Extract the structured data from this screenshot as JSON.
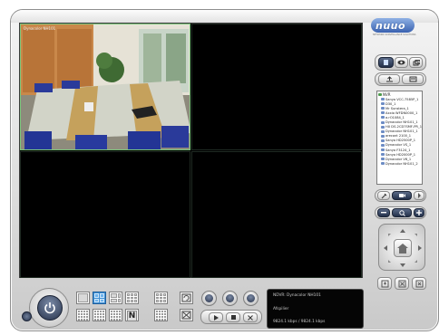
{
  "app": {
    "brand": "nuuo",
    "brand_tagline": "NETWORK SURVEILLANCE SOLUTIONS"
  },
  "colors": {
    "active_cell_border": "#7cc77c",
    "active_layout": "#3f8fd3",
    "screen_bg": "#000000"
  },
  "video_wall": {
    "cells": [
      {
        "label": "Dynacolor NH101",
        "active": true
      },
      {
        "label": "",
        "active": false
      },
      {
        "label": "",
        "active": false
      },
      {
        "label": "",
        "active": false
      }
    ]
  },
  "camera_tree": {
    "root": "NVR",
    "items": [
      "Sanyo VCC-7585P_1",
      "D30_1",
      "Mr Sunstera_1",
      "Axxio WFDN0000_1",
      "a.rO1084_1",
      "Dynacolor NH101_1",
      "HX DS-2CD7SMF-PR_1",
      "Dynacolor NH101_1",
      "arecont 2100_1",
      "Sanyo HD2500P_1",
      "Dynacolor VS_1",
      "Sanyo F3124_1",
      "Sanyo HD2000P_1",
      "Dynacolor V6_1",
      "Dynacolor NH101_2"
    ]
  },
  "side_icons": [
    "monitor-icon",
    "eye-icon",
    "windows-icon",
    "export-icon",
    "import-icon"
  ],
  "status": {
    "line1": "NDVR: Dynacolor NH101",
    "line2": "Afspilier",
    "line3": "9824.1 kbps / 9824.1 kbps"
  },
  "layout_buttons": [
    "1x1",
    "2x2",
    "3x3",
    "4x4",
    "1+5",
    "1+7",
    "4x4b",
    "N"
  ],
  "playback": [
    "play",
    "stop",
    "close"
  ]
}
